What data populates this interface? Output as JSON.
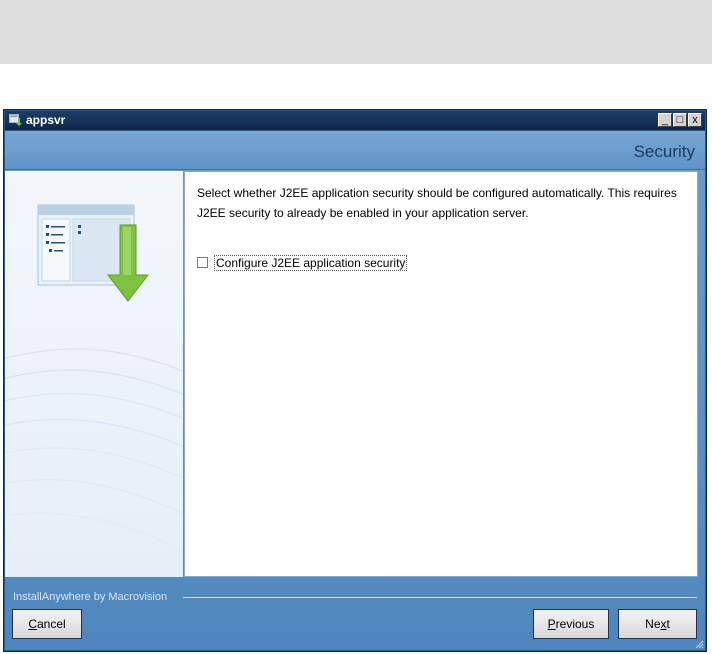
{
  "window": {
    "title": "appsvr",
    "controls": {
      "minimize": "_",
      "maximize": "□",
      "close": "x"
    }
  },
  "header": {
    "step_title": "Security"
  },
  "content": {
    "description": "Select whether J2EE application security should be configured automatically. This requires J2EE security to already be enabled in your application server.",
    "checkbox": {
      "label": "Configure J2EE application security",
      "checked": false
    }
  },
  "footer": {
    "brand": "InstallAnywhere by Macrovision",
    "cancel": {
      "mnemonic": "C",
      "rest": "ancel"
    },
    "previous": {
      "mnemonic": "P",
      "rest": "revious"
    },
    "next": {
      "prefix": "Ne",
      "mnemonic": "x",
      "rest": "t"
    }
  },
  "colors": {
    "accent": "#5f94c8",
    "title_bar": "#0f2747",
    "download_arrow": "#7fc241"
  },
  "icons": [
    "app-icon",
    "installer-illustration",
    "download-arrow-icon"
  ]
}
